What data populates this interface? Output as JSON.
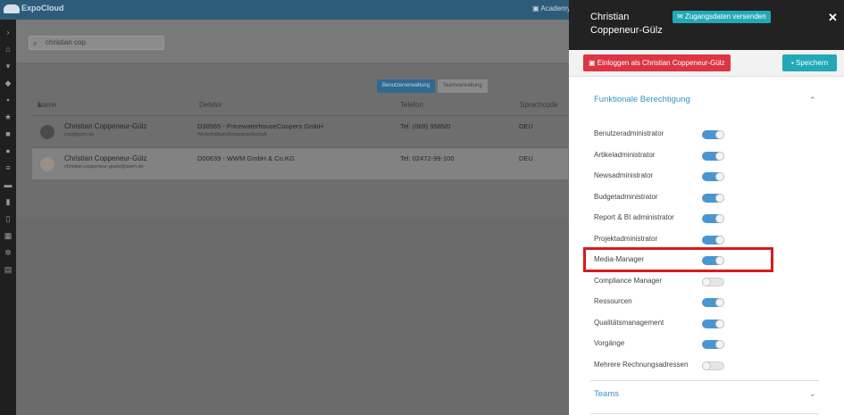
{
  "app": {
    "brand": "ExpoCloud",
    "topright": "Academy"
  },
  "search": {
    "value": "christian cop"
  },
  "tabs": [
    {
      "label": "Benutzerverwaltung"
    },
    {
      "label": "Teamverwaltung"
    }
  ],
  "table": {
    "headers": {
      "name": "Name",
      "debitor": "Debitor",
      "telefon": "Telefon",
      "sprachcode": "Sprachcode"
    },
    "rows": [
      {
        "name": "Christian Coppeneur-Gülz",
        "email": "ccp@pwm.de",
        "debitor": "D38565 - PricewaterhouseCoopers GmbH",
        "debitor_sub": "Wirtschaftsprüfungsgesellschaft",
        "telefon": "Tel: (069) 9585/0",
        "sprachcode": "DEU"
      },
      {
        "name": "Christian Coppeneur-Gülz",
        "email": "christian.coppeneur-guelz@wwm.de",
        "debitor": "D00639 - WWM GmbH & Co.KG",
        "debitor_sub": "",
        "telefon": "Tel: 02472-99-100",
        "sprachcode": "DEU"
      }
    ]
  },
  "panel": {
    "user_name": "Christian Coppeneur-Gülz",
    "send_credentials": "Zugangsdaten versenden",
    "login_as": "Einloggen als Christian Coppeneur-Gülz",
    "save": "Speichern",
    "section_functional": "Funktionale Berechtigung",
    "section_teams": "Teams",
    "permissions": [
      {
        "label": "Benutzeradministrator",
        "enabled": true
      },
      {
        "label": "Artikeladministrator",
        "enabled": true
      },
      {
        "label": "Newsadministrator",
        "enabled": true
      },
      {
        "label": "Budgetadministrator",
        "enabled": true
      },
      {
        "label": "Report & BI administrator",
        "enabled": true
      },
      {
        "label": "Projektadministrator",
        "enabled": true
      },
      {
        "label": "Media-Manager",
        "enabled": true
      },
      {
        "label": "Compliance Manager",
        "enabled": false
      },
      {
        "label": "Ressourcen",
        "enabled": true
      },
      {
        "label": "Qualitätsmanagement",
        "enabled": true
      },
      {
        "label": "Vorgänge",
        "enabled": true
      },
      {
        "label": "Mehrere Rechnungsadressen",
        "enabled": false
      }
    ]
  },
  "colors": {
    "accent": "#23a8b8",
    "danger": "#dc3545",
    "toggle_on": "#4a96d0",
    "highlight": "#d81b1b"
  }
}
